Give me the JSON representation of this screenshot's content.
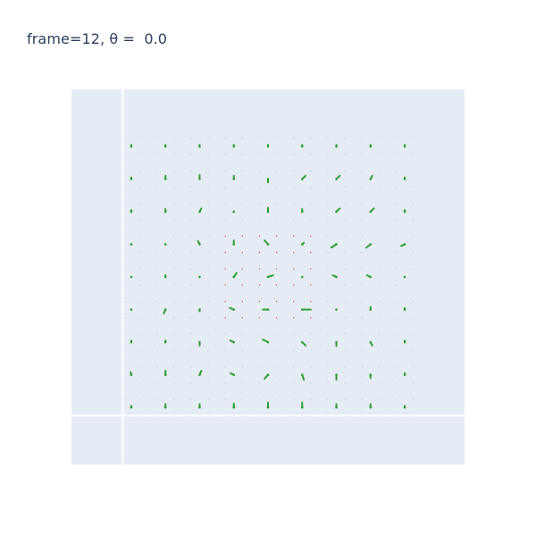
{
  "chart_data": {
    "type": "scatter",
    "title": "frame=12, θ =  0.0",
    "xlabel": "",
    "ylabel": "",
    "xlim": [
      -1.5,
      10
    ],
    "ylim": [
      -1.5,
      10
    ],
    "grid": true,
    "zero_lines": true,
    "series": [
      {
        "kind": "fine-grid-markers",
        "x_range": [
          0,
          8.5
        ],
        "y_range": [
          0,
          8.5
        ],
        "step": 0.5,
        "colors": {
          "outer": "#636efa",
          "inner": "#ef553b",
          "inner_box": [
            3,
            5.5,
            3,
            5.5
          ]
        }
      },
      {
        "kind": "green-markers",
        "color": "#2ca02c",
        "grid_x": [
          0.25,
          1.25,
          2.25,
          3.25,
          4.25,
          5.25,
          6.25,
          7.25,
          8.25
        ],
        "grid_y": [
          0.25,
          1.25,
          2.25,
          3.25,
          4.25,
          5.25,
          6.25,
          7.25,
          8.25
        ],
        "vectors": [
          [
            [
              0.0,
              0.05
            ],
            [
              0.0,
              0.1
            ],
            [
              0.0,
              0.1
            ],
            [
              0.0,
              0.12
            ],
            [
              0.0,
              0.15
            ],
            [
              0.0,
              0.15
            ],
            [
              0.0,
              0.1
            ],
            [
              0.0,
              0.1
            ],
            [
              0.0,
              0.05
            ]
          ],
          [
            [
              -0.02,
              0.08
            ],
            [
              0.0,
              0.12
            ],
            [
              0.05,
              0.12
            ],
            [
              -0.1,
              0.05
            ],
            [
              -0.1,
              -0.12
            ],
            [
              0.05,
              -0.15
            ],
            [
              0.0,
              -0.15
            ],
            [
              0.0,
              -0.1
            ],
            [
              0.0,
              0.05
            ]
          ],
          [
            [
              0.0,
              0.05
            ],
            [
              0.0,
              0.05
            ],
            [
              0.0,
              -0.1
            ],
            [
              -0.1,
              0.05
            ],
            [
              -0.15,
              0.08
            ],
            [
              0.1,
              -0.1
            ],
            [
              0.0,
              -0.12
            ],
            [
              0.05,
              -0.1
            ],
            [
              0.0,
              0.05
            ]
          ],
          [
            [
              0.0,
              0.0
            ],
            [
              -0.05,
              -0.12
            ],
            [
              0.0,
              -0.05
            ],
            [
              -0.12,
              0.05
            ],
            [
              -0.15,
              0.0
            ],
            [
              0.25,
              0.0
            ],
            [
              0.0,
              0.0
            ],
            [
              0.0,
              0.08
            ],
            [
              0.0,
              0.05
            ]
          ],
          [
            [
              0.0,
              0.0
            ],
            [
              0.0,
              0.05
            ],
            [
              0.0,
              0.0
            ],
            [
              0.08,
              0.12
            ],
            [
              0.15,
              0.05
            ],
            [
              0.0,
              0.0
            ],
            [
              -0.1,
              0.05
            ],
            [
              -0.1,
              0.05
            ],
            [
              0.0,
              0.0
            ]
          ],
          [
            [
              0.0,
              0.0
            ],
            [
              0.0,
              0.0
            ],
            [
              -0.05,
              0.1
            ],
            [
              0.0,
              0.12
            ],
            [
              -0.1,
              0.12
            ],
            [
              0.05,
              0.05
            ],
            [
              -0.15,
              -0.1
            ],
            [
              -0.12,
              -0.1
            ],
            [
              -0.1,
              -0.05
            ]
          ],
          [
            [
              0.0,
              0.05
            ],
            [
              0.0,
              0.08
            ],
            [
              0.05,
              0.1
            ],
            [
              0.0,
              0.0
            ],
            [
              0.0,
              0.12
            ],
            [
              0.0,
              0.08
            ],
            [
              0.1,
              0.1
            ],
            [
              0.1,
              0.1
            ],
            [
              0.0,
              0.05
            ]
          ],
          [
            [
              0.0,
              0.05
            ],
            [
              0.0,
              0.1
            ],
            [
              0.0,
              0.12
            ],
            [
              0.0,
              0.1
            ],
            [
              0.0,
              -0.1
            ],
            [
              0.1,
              0.1
            ],
            [
              0.1,
              0.1
            ],
            [
              0.05,
              0.1
            ],
            [
              0.0,
              0.05
            ]
          ],
          [
            [
              0.0,
              0.05
            ],
            [
              0.0,
              0.05
            ],
            [
              0.0,
              0.05
            ],
            [
              0.0,
              0.05
            ],
            [
              0.0,
              0.05
            ],
            [
              0.0,
              0.05
            ],
            [
              0.0,
              0.05
            ],
            [
              0.0,
              0.05
            ],
            [
              0.0,
              0.05
            ]
          ]
        ]
      }
    ],
    "style": {
      "plot_bg": "#e5ecf6",
      "zero_line": "#ffffff",
      "title_color": "#2a3f5f"
    }
  }
}
